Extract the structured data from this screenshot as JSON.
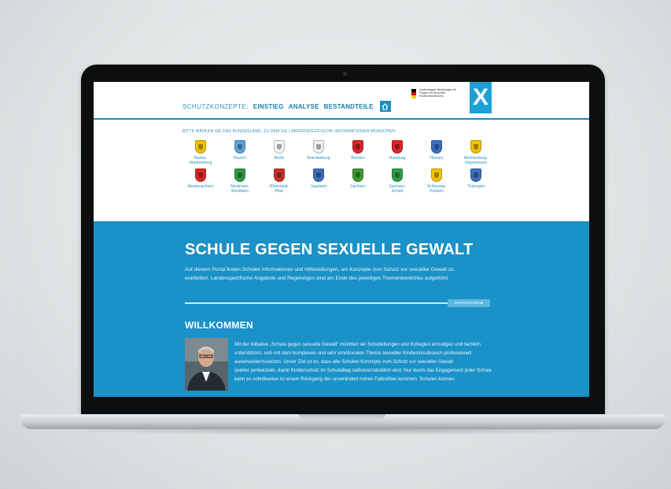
{
  "nav": {
    "label": "SCHUTZKONZEPTE:",
    "items": [
      "EINSTIEG",
      "ANALYSE",
      "BESTANDTEILE"
    ]
  },
  "ministry_text": "Unabhängiger Beauftragter für Fragen des sexuellen Kindesmissbrauchs",
  "logo_letter": "X",
  "states_prompt": "BITTE WÄHLEN SIE DAS BUNDESLAND, ZU DEM SIE LÄNDERSPEZIFISCHE INFORMATIONEN WÜNSCHEN:",
  "states": [
    {
      "name": "Baden-\nWürttemberg",
      "color": "#f2c200"
    },
    {
      "name": "Bayern",
      "color": "#5fa3d8"
    },
    {
      "name": "Berlin",
      "color": "#f4f4f4"
    },
    {
      "name": "Brandenburg",
      "color": "#f0eeee"
    },
    {
      "name": "Bremen",
      "color": "#d8262a"
    },
    {
      "name": "Hamburg",
      "color": "#d8262a"
    },
    {
      "name": "Hessen",
      "color": "#3a6fbf"
    },
    {
      "name": "Mecklenburg-\nVorpommern",
      "color": "#f2c200"
    },
    {
      "name": "Niedersachsen",
      "color": "#d8262a"
    },
    {
      "name": "Nordrhein-\nWestfalen",
      "color": "#2f9a45"
    },
    {
      "name": "Rheinland-\nPfalz",
      "color": "#c9302c"
    },
    {
      "name": "Saarland",
      "color": "#3a6fbf"
    },
    {
      "name": "Sachsen",
      "color": "#3f9a34"
    },
    {
      "name": "Sachsen-\nAnhalt",
      "color": "#2f9a45"
    },
    {
      "name": "Schleswig-\nHolstein",
      "color": "#f2c200"
    },
    {
      "name": "Thüringen",
      "color": "#3a6fbf"
    }
  ],
  "hero": {
    "title": "SCHULE GEGEN SEXUELLE GEWALT",
    "text": "Auf diesem Portal finden Schulen Informationen und Hilfestellungen, um Konzepte zum Schutz vor sexueller Gewalt zu erarbeiten. Landesspezifische Angebote und Regelungen sind am Ende des jeweiligen Themenbereiches aufgeführt.",
    "more": "WEITERLESEN ▶"
  },
  "welcome": {
    "title": "WILLKOMMEN",
    "text": "Mit der Initiative „Schule gegen sexuelle Gewalt“ möchten wir Schulleitungen und Kollegien ermutigen und fachlich unterstützen, sich mit dem komplexen und sehr emotionalen Thema sexueller Kindesmissbrauch professionell auseinanderzusetzen. Unser Ziel ist es, dass alle Schulen Konzepte zum Schutz vor sexueller Gewalt (weiter-)entwickeln, damit Kinderschutz im Schulalltag selbstverständlich wird. Nur durch das Engagement jeder Schule kann es schrittweise zu einem Rückgang der unverändert hohen Fallzahlen kommen. Schulen können"
  }
}
